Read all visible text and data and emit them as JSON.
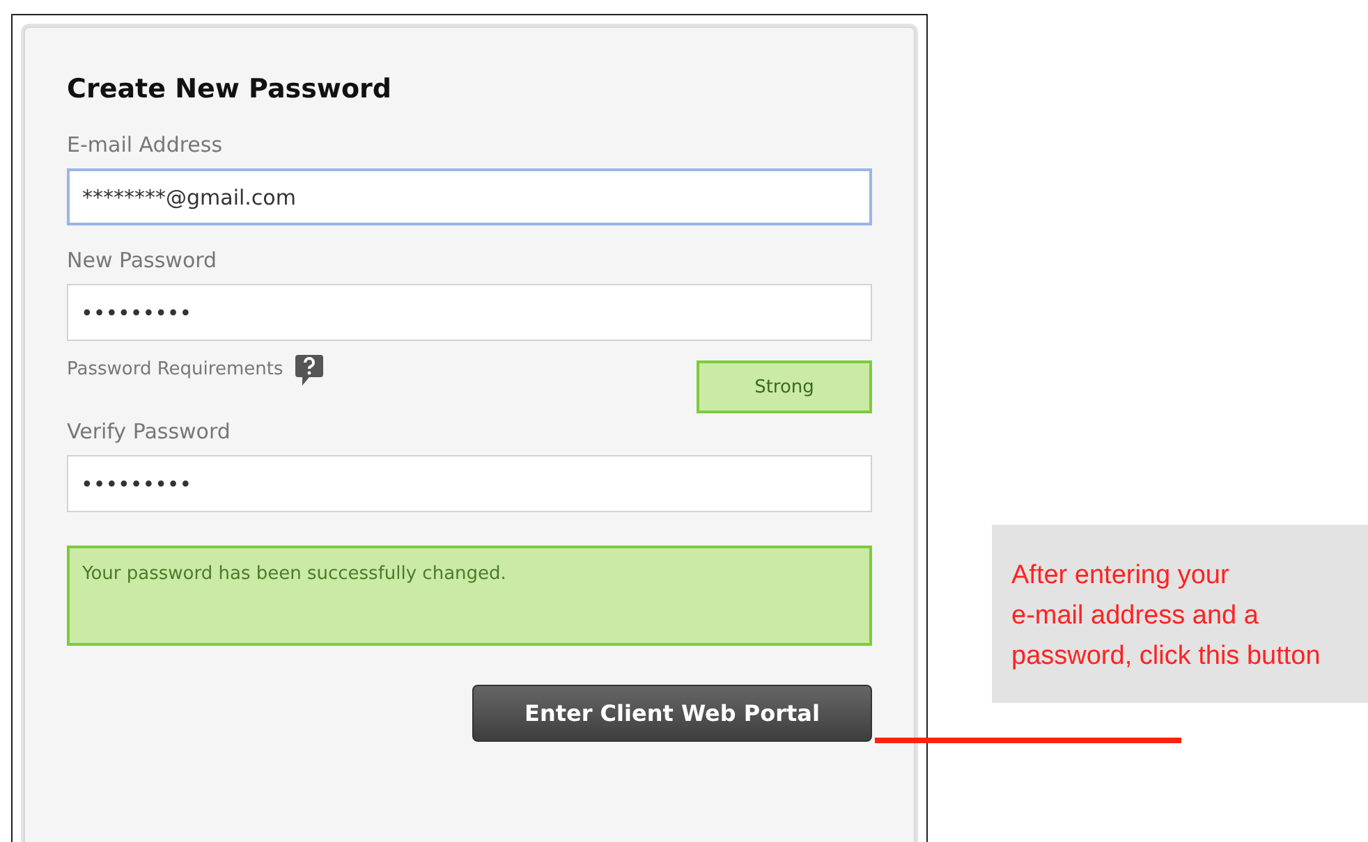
{
  "form": {
    "title": "Create New Password",
    "fields": [
      {
        "label": "E-mail Address",
        "value": "********@gmail.com",
        "focused": true
      },
      {
        "label": "New Password",
        "value": "•••••••••",
        "focused": false
      },
      {
        "label": "Verify Password",
        "value": "•••••••••",
        "focused": false
      }
    ],
    "requirements_label": "Password Requirements",
    "strength": "Strong",
    "message": "Your password has been successfully changed.",
    "submit_button": "Enter Client Web Portal"
  },
  "callout": {
    "lines": [
      "After entering your",
      "e-mail address and a",
      "password, click this button"
    ]
  }
}
